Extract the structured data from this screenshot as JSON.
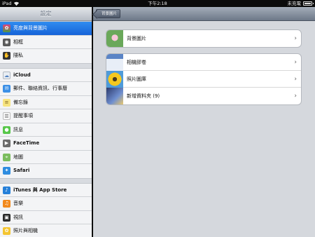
{
  "status_bar": {
    "carrier": "iPad",
    "wifi_icon": "wifi-icon",
    "time": "下午2:18",
    "charging": "未充電",
    "battery_icon": "battery-icon"
  },
  "master": {
    "title": "設定",
    "groups": [
      [
        {
          "label": "亮度與背景圖片",
          "icon": "wallpaper-icon",
          "selected": true
        },
        {
          "label": "相框",
          "icon": "picture-frame-icon"
        },
        {
          "label": "隱私",
          "icon": "privacy-hand-icon"
        }
      ],
      [
        {
          "label": "iCloud",
          "icon": "icloud-icon",
          "bold": true
        },
        {
          "label": "郵件、聯絡資訊、行事曆",
          "icon": "mail-icon"
        },
        {
          "label": "備忘錄",
          "icon": "notes-icon"
        },
        {
          "label": "提醒事項",
          "icon": "reminders-icon"
        },
        {
          "label": "訊息",
          "icon": "messages-icon"
        },
        {
          "label": "FaceTime",
          "icon": "facetime-icon",
          "bold": true
        },
        {
          "label": "地圖",
          "icon": "maps-icon"
        },
        {
          "label": "Safari",
          "icon": "safari-icon",
          "bold": true
        }
      ],
      [
        {
          "label": "iTunes 與 App Store",
          "icon": "itunes-icon",
          "bold": true
        },
        {
          "label": "音樂",
          "icon": "music-icon"
        },
        {
          "label": "視訊",
          "icon": "videos-icon"
        },
        {
          "label": "照片與相機",
          "icon": "photos-icon"
        }
      ]
    ]
  },
  "detail": {
    "back_label": "背景圖片",
    "card1": [
      {
        "label": "背景圖片",
        "thumb": "wallpaper-thumbnail"
      }
    ],
    "card2": [
      {
        "label": "相機膠卷",
        "thumb": "camera-roll-thumbnail"
      },
      {
        "label": "照片圖庫",
        "thumb": "photo-library-thumbnail"
      },
      {
        "label": "新增資料夾 (9)",
        "thumb": "new-album-thumbnail"
      }
    ],
    "chevron_icon": "chevron-right-icon"
  }
}
